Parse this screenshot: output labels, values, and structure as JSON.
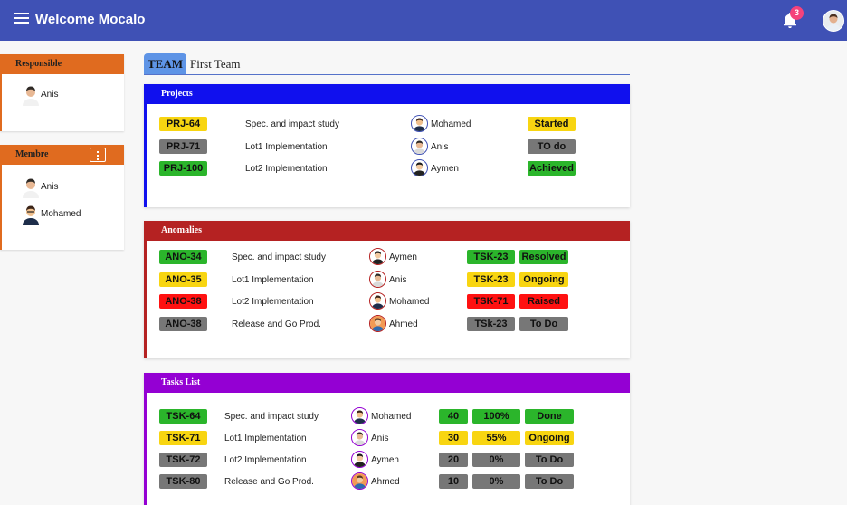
{
  "header": {
    "title": "Welcome Mocalo",
    "notifications": "3"
  },
  "colors": {
    "header": "#3f51b5",
    "side": "#e06b1f",
    "projects": "#1010ee",
    "anomalies": "#b52222",
    "tasks": "#9400d3",
    "green": "#2bb52b",
    "yellow": "#f8d511",
    "gray": "#777777",
    "red": "#ff1111"
  },
  "responsible": {
    "title": "Responsible",
    "people": [
      "Anis"
    ]
  },
  "members": {
    "title": "Membre",
    "people": [
      "Anis",
      "Mohamed"
    ]
  },
  "team": {
    "tag": "TEAM",
    "name": "First Team"
  },
  "projects": {
    "title": "Projects",
    "rows": [
      {
        "id": "PRJ-64",
        "id_color": "yellow",
        "desc": "Spec. and impact study",
        "person": "Mohamed",
        "status": "Started",
        "status_color": "yellow"
      },
      {
        "id": "PRJ-71",
        "id_color": "gray",
        "desc": "Lot1 Implementation",
        "person": "Anis",
        "status": "TO do",
        "status_color": "gray"
      },
      {
        "id": "PRJ-100",
        "id_color": "green",
        "desc": "Lot2 Implementation",
        "person": "Aymen",
        "status": "Achieved",
        "status_color": "green"
      }
    ]
  },
  "anomalies": {
    "title": "Anomalies",
    "rows": [
      {
        "id": "ANO-34",
        "id_color": "green",
        "desc": "Spec. and impact study",
        "person": "Aymen",
        "task": "TSK-23",
        "task_color": "green",
        "status": "Resolved",
        "status_color": "green"
      },
      {
        "id": "ANO-35",
        "id_color": "yellow",
        "desc": "Lot1 Implementation",
        "person": "Anis",
        "task": "TSK-23",
        "task_color": "yellow",
        "status": "Ongoing",
        "status_color": "yellow"
      },
      {
        "id": "ANO-38",
        "id_color": "red",
        "desc": "Lot2 Implementation",
        "person": "Mohamed",
        "task": "TSK-71",
        "task_color": "red",
        "status": "Raised",
        "status_color": "red"
      },
      {
        "id": "ANO-38",
        "id_color": "gray",
        "desc": "Release and Go Prod.",
        "person": "Ahmed",
        "task": "TSk-23",
        "task_color": "gray",
        "status": "To Do",
        "status_color": "gray"
      }
    ]
  },
  "tasks": {
    "title": "Tasks List",
    "rows": [
      {
        "id": "TSK-64",
        "id_color": "green",
        "desc": "Spec. and impact study",
        "person": "Mohamed",
        "hours": "40",
        "progress": "100%",
        "status": "Done",
        "color": "green"
      },
      {
        "id": "TSK-71",
        "id_color": "yellow",
        "desc": "Lot1 Implementation",
        "person": "Anis",
        "hours": "30",
        "progress": "55%",
        "status": "Ongoing",
        "color": "yellow"
      },
      {
        "id": "TSK-72",
        "id_color": "gray",
        "desc": "Lot2 Implementation",
        "person": "Aymen",
        "hours": "20",
        "progress": "0%",
        "status": "To Do",
        "color": "gray"
      },
      {
        "id": "TSK-80",
        "id_color": "gray",
        "desc": "Release and Go Prod.",
        "person": "Ahmed",
        "hours": "10",
        "progress": "0%",
        "status": "To Do",
        "color": "gray"
      }
    ]
  }
}
